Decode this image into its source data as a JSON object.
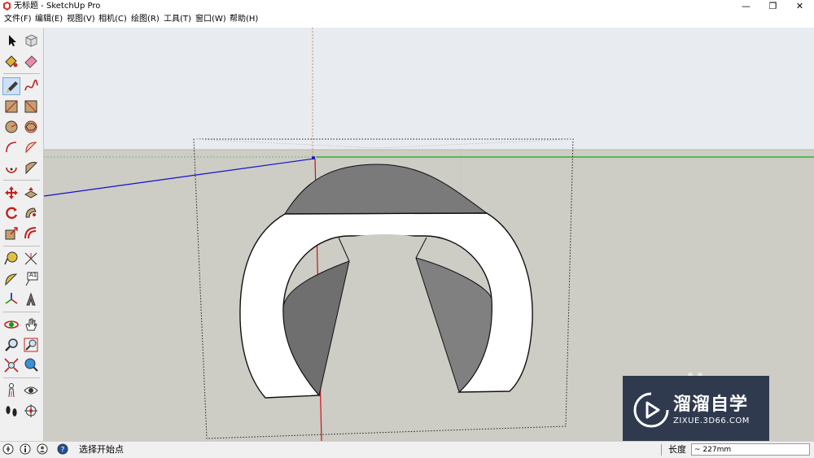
{
  "window": {
    "title": "无标题 - SketchUp Pro",
    "app_icon": "sketchup-logo-icon",
    "controls": {
      "minimize": "—",
      "maximize": "❐",
      "close": "✕"
    }
  },
  "menu": [
    {
      "label": "文件(F)"
    },
    {
      "label": "编辑(E)"
    },
    {
      "label": "视图(V)"
    },
    {
      "label": "相机(C)"
    },
    {
      "label": "绘图(R)"
    },
    {
      "label": "工具(T)"
    },
    {
      "label": "窗口(W)"
    },
    {
      "label": "帮助(H)"
    }
  ],
  "toolbar": {
    "active_tool": "line-tool",
    "tools": [
      "select-tool",
      "component-tool",
      "paint-bucket-tool",
      "eraser-tool",
      "line-tool",
      "freehand-tool",
      "rectangle-tool",
      "rotated-rectangle-tool",
      "circle-tool",
      "polygon-tool",
      "arc-tool",
      "pie-tool",
      "two-point-arc-tool",
      "three-point-arc-tool",
      "move-tool",
      "push-pull-tool",
      "rotate-tool",
      "follow-me-tool",
      "scale-tool",
      "offset-tool",
      "tape-measure-tool",
      "dimension-tool",
      "protractor-tool",
      "text-tool",
      "axes-tool",
      "3d-text-tool",
      "orbit-tool",
      "pan-tool",
      "zoom-tool",
      "zoom-window-tool",
      "zoom-extents-tool",
      "previous-view-tool",
      "position-camera-tool",
      "look-around-tool",
      "walk-tool",
      "section-plane-tool"
    ],
    "text_tool_glyph": "A1"
  },
  "colors": {
    "sky": "#e8ebef",
    "ground": "#cdccc5",
    "red_axis": "#d01010",
    "green_axis": "#10b010",
    "blue_axis": "#1010d0",
    "watermark_bg": "#2f3a4f"
  },
  "watermark": {
    "title": "溜溜自学",
    "url": "ZIXUE.3D66.COM"
  },
  "status": {
    "prompt": "选择开始点",
    "measure_label": "长度",
    "measure_value": "~ 227mm"
  }
}
